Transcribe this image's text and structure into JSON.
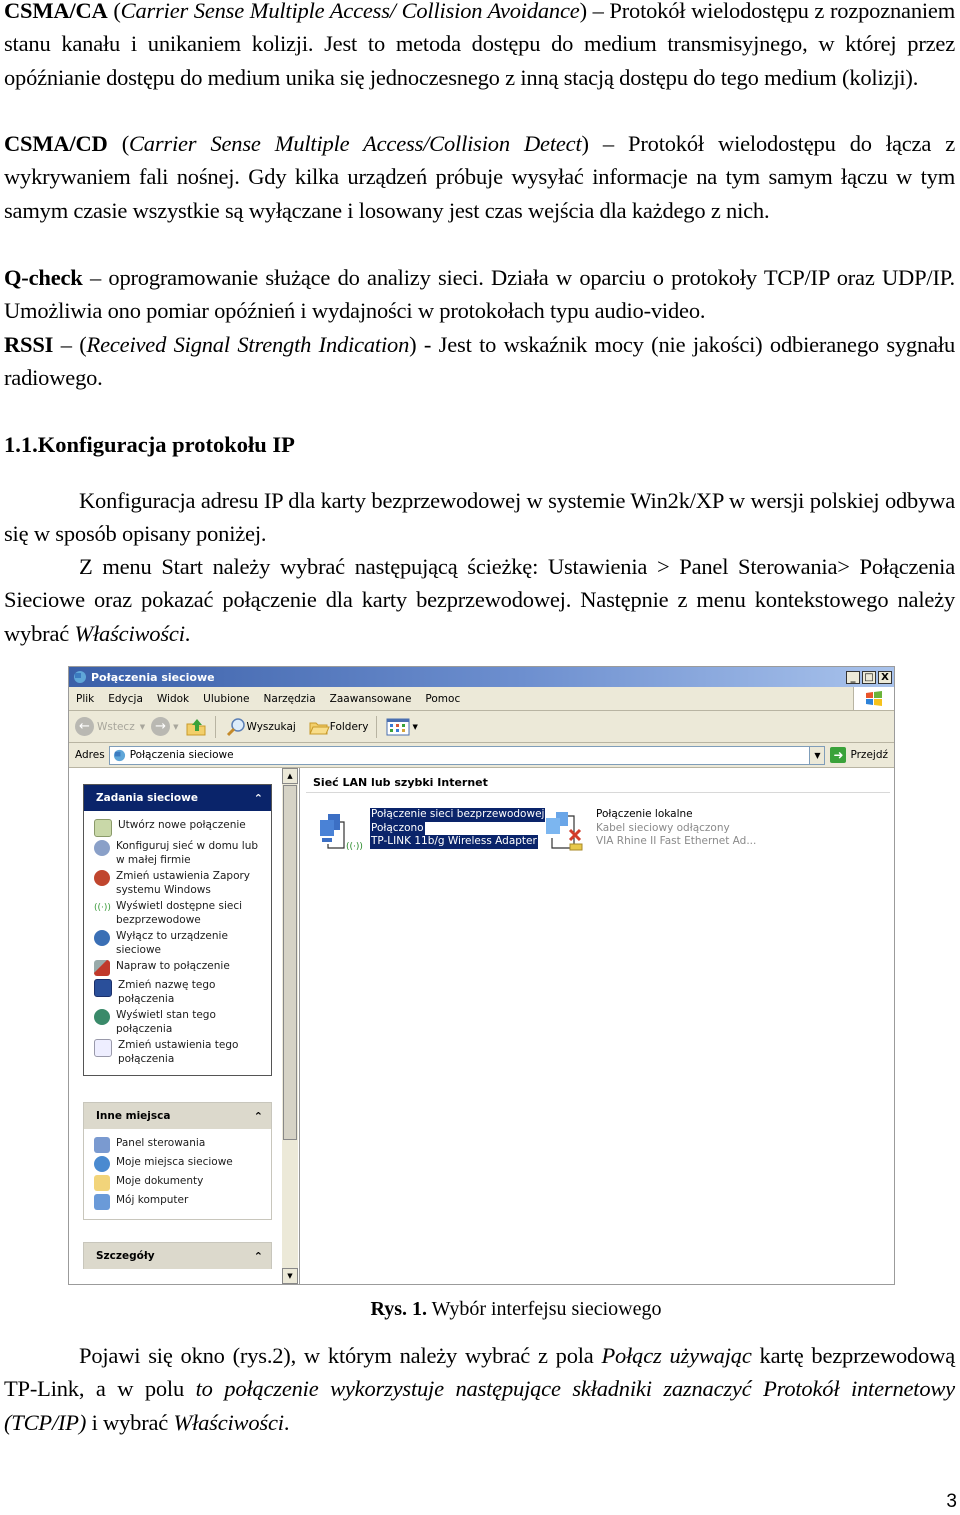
{
  "paragraphs": {
    "csma_ca": {
      "term": "CSMA/CA",
      "expansion": "Carrier Sense Multiple Access/ Collision Avoidance",
      "text": "– Protokół wielodostępu z rozpoznaniem stanu kanału i unikaniem kolizji. Jest to metoda dostępu do medium transmisyjnego, w której przez opóźnianie dostępu do medium unika się jednoczesnego z inną stacją dostępu do tego medium (kolizji)."
    },
    "csma_cd": {
      "term": "CSMA/CD",
      "expansion": "Carrier Sense Multiple Access/Collision Detect",
      "text": "– Protokół wielodostępu do łącza z wykrywaniem fali nośnej. Gdy kilka urządzeń próbuje wysyłać informacje na tym samym łączu w tym samym czasie wszystkie są wyłączane i losowany jest czas wejścia dla każdego z nich."
    },
    "qcheck": {
      "term": "Q-check",
      "text": "– oprogramowanie służące do analizy sieci. Działa w oparciu o protokoły TCP/IP oraz UDP/IP. Umożliwia ono pomiar opóźnień i wydajności w protokołach typu audio-video."
    },
    "rssi": {
      "term": "RSSI",
      "dash": "–",
      "expansion": "Received Signal Strength Indication",
      "text": "- Jest to wskaźnik mocy (nie jakości) odbieranego sygnału radiowego."
    },
    "heading": "1.1.Konfiguracja protokołu IP",
    "intro": "Konfiguracja adresu IP dla karty bezprzewodowej w systemie Win2k/XP w wersji polskiej odbywa się w sposób opisany poniżej.",
    "path_text": "Z menu Start należy wybrać następującą ścieżkę: Ustawienia > Panel Sterowania> Połączenia Sieciowe oraz pokazać połączenie dla karty bezprzewodowej. Następnie z menu kontekstowego należy wybrać",
    "path_italic": "Właściwości",
    "path_end": ".",
    "after_1": "Pojawi się okno (rys.2), w którym należy wybrać z pola",
    "after_i1": "Połącz używając",
    "after_2": "kartę bezprzewodową TP-Link, a w polu",
    "after_i2": "to połączenie wykorzystuje następujące składniki zaznaczyć Protokół internetowy (TCP/IP)",
    "after_3": "i wybrać",
    "after_i3": "Właściwości",
    "after_4": "."
  },
  "caption": {
    "label": "Rys. 1.",
    "text": "Wybór interfejsu sieciowego"
  },
  "page_number": "3",
  "window": {
    "title": "Połączenia sieciowe",
    "controls": {
      "minimize": "_",
      "maximize": "□",
      "close": "X"
    },
    "menu": [
      "Plik",
      "Edycja",
      "Widok",
      "Ulubione",
      "Narzędzia",
      "Zaawansowane",
      "Pomoc"
    ],
    "toolbar": {
      "back": "Wstecz",
      "search": "Wyszukaj",
      "folders": "Foldery"
    },
    "address": {
      "label": "Adres",
      "value": "Połączenia sieciowe",
      "go": "Przejdź"
    },
    "network_tasks": {
      "title": "Zadania sieciowe",
      "items": [
        "Utwórz nowe połączenie",
        "Konfiguruj sieć w domu lub w małej firmie",
        "Zmień ustawienia Zapory systemu Windows",
        "Wyświetl dostępne sieci bezprzewodowe",
        "Wyłącz to urządzenie sieciowe",
        "Napraw to połączenie",
        "Zmień nazwę tego połączenia",
        "Wyświetl stan tego połączenia",
        "Zmień ustawienia tego połączenia"
      ]
    },
    "other_places": {
      "title": "Inne miejsca",
      "items": [
        "Panel sterowania",
        "Moje miejsca sieciowe",
        "Moje dokumenty",
        "Mój komputer"
      ]
    },
    "details": {
      "title": "Szczegóły"
    },
    "group_title": "Sieć LAN lub szybki Internet",
    "connections": [
      {
        "name": "Połączenie sieci bezprzewodowej",
        "status": "Połączono",
        "device": "TP-LINK 11b/g Wireless Adapter",
        "selected": true
      },
      {
        "name": "Połączenie lokalne",
        "status": "Kabel sieciowy odłączony",
        "device": "VIA Rhine II Fast Ethernet Ad...",
        "selected": false
      }
    ],
    "colors": {
      "titlebar": "#3a5fa8",
      "task_header": "#0a246a",
      "selection": "#0a246a",
      "chrome": "#ece9d8"
    }
  }
}
